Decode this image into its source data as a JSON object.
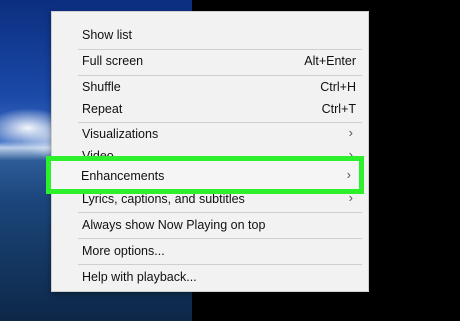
{
  "menu": {
    "items": [
      {
        "label": "Show list",
        "shortcut": ""
      },
      {
        "label": "Full screen",
        "shortcut": "Alt+Enter"
      },
      {
        "label": "Shuffle",
        "shortcut": "Ctrl+H"
      },
      {
        "label": "Repeat",
        "shortcut": "Ctrl+T"
      },
      {
        "label": "Visualizations",
        "submenu": "›"
      },
      {
        "label": "Video",
        "submenu": "›"
      },
      {
        "label": "Enhancements",
        "submenu": "›"
      },
      {
        "label": "Lyrics, captions, and subtitles",
        "submenu": "›"
      },
      {
        "label": "Always show Now Playing on top",
        "shortcut": ""
      },
      {
        "label": "More options...",
        "shortcut": ""
      },
      {
        "label": "Help with playback...",
        "shortcut": ""
      }
    ]
  },
  "highlight_color": "#2cf02c"
}
